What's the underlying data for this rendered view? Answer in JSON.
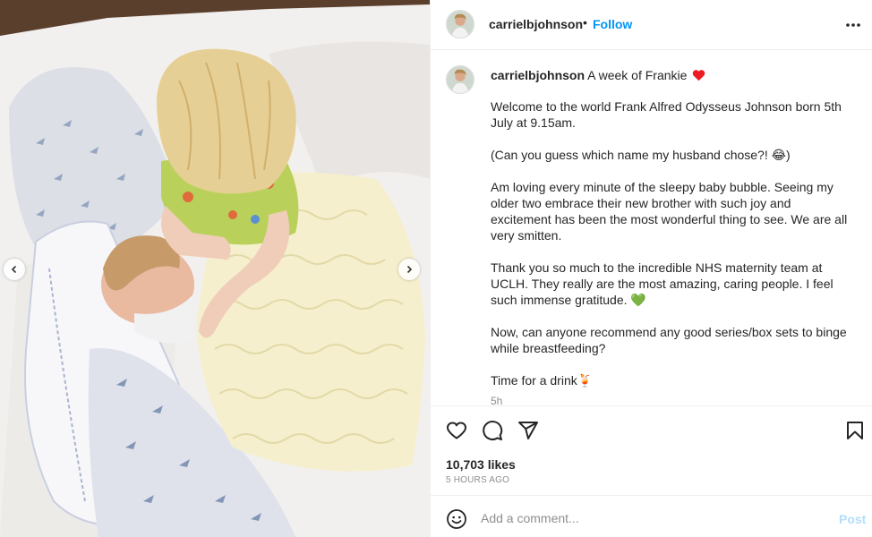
{
  "post": {
    "username": "carrielbjohnson",
    "header_separator": "•",
    "follow_label": "Follow",
    "caption_title": "A week of Frankie",
    "caption_paragraphs": [
      "Welcome to the world Frank Alfred Odysseus Johnson born 5th July at 9.15am.",
      "(Can you guess which name my husband chose?! 😂)",
      "Am loving every minute of the sleepy baby bubble. Seeing my older two embrace their new brother with such joy and excitement has been the most wonderful thing to see. We are all very smitten.",
      "Thank you so much to the incredible NHS maternity team at UCLH. They really are the most amazing, caring people. I feel such immense gratitude. 💚",
      "Now, can anyone recommend any good series/box sets to binge while breastfeeding?",
      "Time for a drink🍹"
    ],
    "caption_timestamp": "5h",
    "likes": "10,703 likes",
    "time_ago": "5 HOURS AGO"
  },
  "comment": {
    "placeholder": "Add a comment...",
    "post_label": "Post"
  },
  "icons": {
    "more": "more-horizontal-icon",
    "like": "heart-outline-icon",
    "comment": "speech-bubble-icon",
    "share": "paper-plane-icon",
    "save": "bookmark-icon",
    "emoji": "smiley-icon",
    "prev": "chevron-left-icon",
    "next": "chevron-right-icon"
  },
  "colors": {
    "follow": "#0095f6",
    "post_disabled": "#b2dffc",
    "heart_emoji": "#ed1c24",
    "green_heart": "#2ecc40",
    "text": "#262626",
    "muted": "#8e8e8e"
  }
}
